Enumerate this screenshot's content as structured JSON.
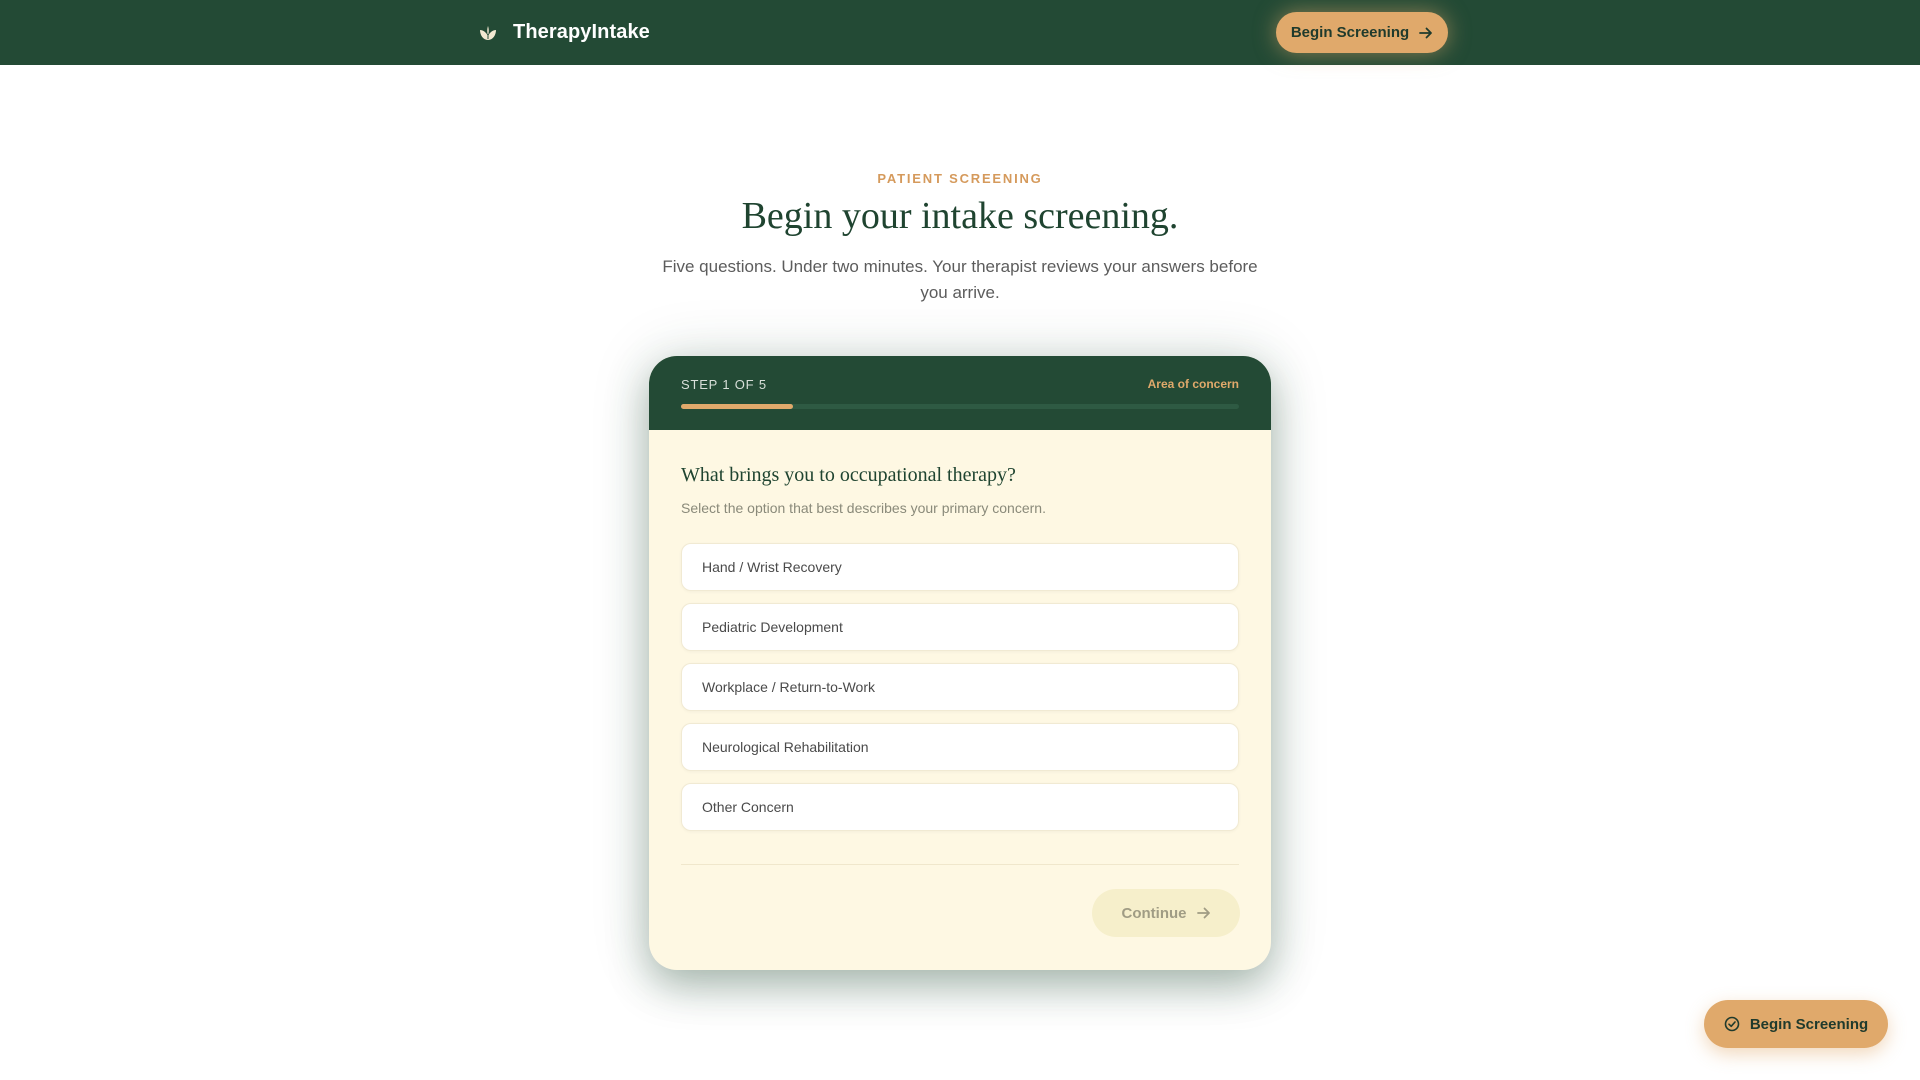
{
  "nav": {
    "brand_name": "TherapyIntake",
    "brand_icon": "leaf-icon",
    "cta_label": "Begin Screening",
    "cta_icon": "arrow-right-icon"
  },
  "hero": {
    "eyebrow": "PATIENT SCREENING",
    "title": "Begin your intake screening.",
    "subtitle": "Five questions. Under two minutes. Your therapist reviews your answers before you arrive."
  },
  "card": {
    "step_label": "STEP 1 OF 5",
    "step_name": "Area of concern",
    "progress": 0.2,
    "question": "What brings you to occupational therapy?",
    "hint": "Select the option that best describes your primary concern.",
    "options": [
      {
        "label": "Hand / Wrist Recovery"
      },
      {
        "label": "Pediatric Development"
      },
      {
        "label": "Workplace / Return-to-Work"
      },
      {
        "label": "Neurological Rehabilitation"
      },
      {
        "label": "Other Concern"
      }
    ],
    "continue_label": "Continue",
    "continue_icon": "arrow-right-icon"
  },
  "floating_cta": {
    "label": "Begin Screening",
    "icon": "shield-check-icon"
  },
  "colors": {
    "primary_green": "#234a35",
    "accent_orange": "#e0a96b",
    "card_cream": "#fef8e3",
    "title_green": "#1f4430"
  }
}
